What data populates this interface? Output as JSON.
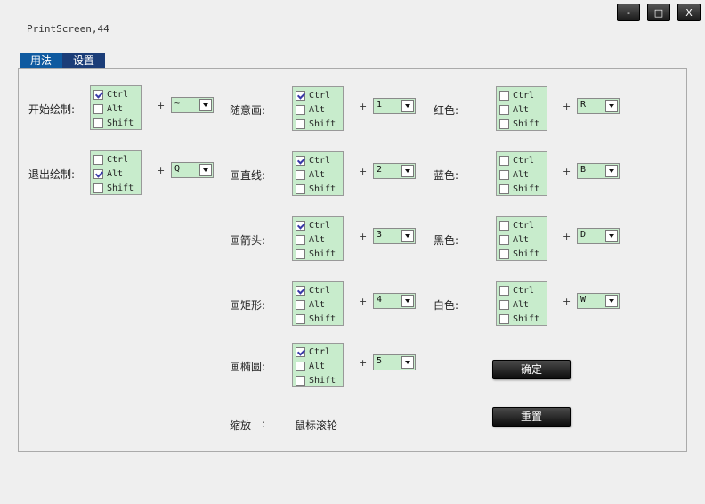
{
  "app": {
    "title": "PrintScreen,44"
  },
  "window_controls": {
    "minimize": "-",
    "maximize": "□",
    "close": "X"
  },
  "tabs": [
    {
      "label": "用法"
    },
    {
      "label": "设置"
    }
  ],
  "modifiers": {
    "ctrl": "Ctrl",
    "alt": "Alt",
    "shift": "Shift"
  },
  "plus_sign": "+",
  "hotkeys": {
    "start_draw": {
      "label": "开始绘制:",
      "ctrl": true,
      "alt": false,
      "shift": false,
      "key": "~"
    },
    "exit_draw": {
      "label": "退出绘制:",
      "ctrl": false,
      "alt": true,
      "shift": false,
      "key": "Q"
    },
    "freehand": {
      "label": "随意画:",
      "ctrl": true,
      "alt": false,
      "shift": false,
      "key": "1"
    },
    "line": {
      "label": "画直线:",
      "ctrl": true,
      "alt": false,
      "shift": false,
      "key": "2"
    },
    "arrow": {
      "label": "画箭头:",
      "ctrl": true,
      "alt": false,
      "shift": false,
      "key": "3"
    },
    "rectangle": {
      "label": "画矩形:",
      "ctrl": true,
      "alt": false,
      "shift": false,
      "key": "4"
    },
    "ellipse": {
      "label": "画椭圆:",
      "ctrl": true,
      "alt": false,
      "shift": false,
      "key": "5"
    },
    "red": {
      "label": "红色:",
      "ctrl": false,
      "alt": false,
      "shift": false,
      "key": "R"
    },
    "blue": {
      "label": "蓝色:",
      "ctrl": false,
      "alt": false,
      "shift": false,
      "key": "B"
    },
    "black": {
      "label": "黑色:",
      "ctrl": false,
      "alt": false,
      "shift": false,
      "key": "D"
    },
    "white": {
      "label": "白色:",
      "ctrl": false,
      "alt": false,
      "shift": false,
      "key": "W"
    }
  },
  "zoom": {
    "label": "缩放",
    "separator": ":",
    "value": "鼠标滚轮"
  },
  "buttons": {
    "confirm": "确定",
    "reset": "重置"
  },
  "colors": {
    "tab_active": "#1b3d78",
    "tab_inactive": "#0f5aa0",
    "field_bg": "#c8eccc"
  }
}
